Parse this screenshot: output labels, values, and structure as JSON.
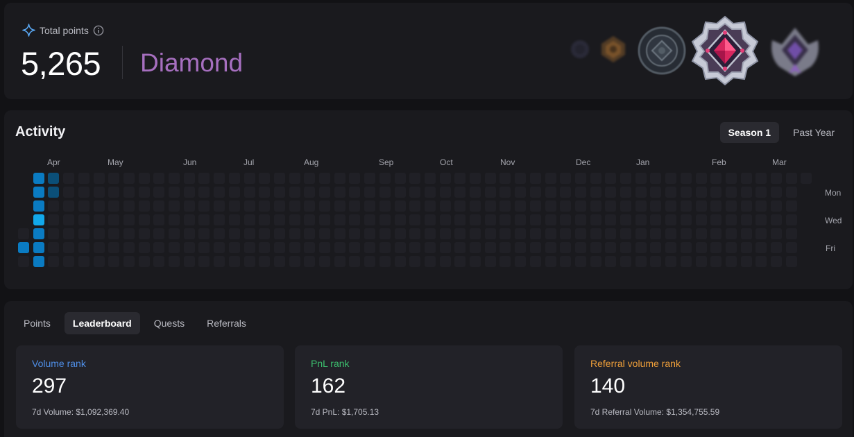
{
  "points": {
    "label": "Total points",
    "value": "5,265",
    "tier": "Diamond",
    "icons": {
      "label_icon": "sparkle-icon",
      "info_icon": "info-icon"
    },
    "badges": [
      "bronze-badge-icon",
      "gold-badge-icon",
      "silver-badge-icon",
      "diamond-badge-icon",
      "master-badge-icon"
    ]
  },
  "activity": {
    "title": "Activity",
    "range_options": [
      {
        "label": "Season 1",
        "active": true
      },
      {
        "label": "Past Year",
        "active": false
      }
    ],
    "months": [
      "Apr",
      "May",
      "Jun",
      "Jul",
      "Aug",
      "Sep",
      "Oct",
      "Nov",
      "Dec",
      "Jan",
      "Feb",
      "Mar"
    ],
    "day_labels": [
      "Mon",
      "Wed",
      "Fri"
    ],
    "weeks": 53,
    "levels": {
      "empty": "#202026",
      "low": "#0b4f78",
      "mid": "#0a7bc2",
      "high": "#12a8ea"
    },
    "active_cells": [
      {
        "week": 0,
        "day": 5,
        "level": "mid"
      },
      {
        "week": 1,
        "day": 0,
        "level": "mid"
      },
      {
        "week": 1,
        "day": 1,
        "level": "mid"
      },
      {
        "week": 1,
        "day": 2,
        "level": "mid"
      },
      {
        "week": 1,
        "day": 3,
        "level": "high"
      },
      {
        "week": 1,
        "day": 4,
        "level": "mid"
      },
      {
        "week": 1,
        "day": 5,
        "level": "mid"
      },
      {
        "week": 1,
        "day": 6,
        "level": "mid"
      },
      {
        "week": 2,
        "day": 0,
        "level": "low"
      },
      {
        "week": 2,
        "day": 1,
        "level": "low"
      }
    ]
  },
  "leaderboard": {
    "tabs": [
      {
        "label": "Points",
        "active": false
      },
      {
        "label": "Leaderboard",
        "active": true
      },
      {
        "label": "Quests",
        "active": false
      },
      {
        "label": "Referrals",
        "active": false
      }
    ],
    "ranks": [
      {
        "label": "Volume rank",
        "value": "297",
        "sub": "7d Volume: $1,092,369.40",
        "color": "#4f8fe8"
      },
      {
        "label": "PnL rank",
        "value": "162",
        "sub": "7d PnL: $1,705.13",
        "color": "#3cbf6e"
      },
      {
        "label": "Referral volume rank",
        "value": "140",
        "sub": "7d Referral Volume: $1,354,755.59",
        "color": "#f0a03a"
      }
    ]
  }
}
